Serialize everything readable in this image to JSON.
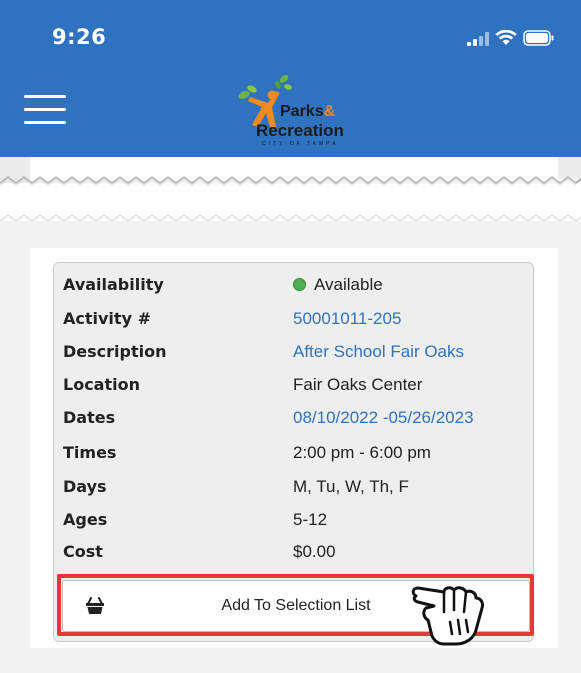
{
  "status_bar": {
    "time": "9:26",
    "icons": [
      "signal-icon",
      "wifi-icon",
      "battery-icon"
    ]
  },
  "header": {
    "menu_icon": "hamburger-menu-icon",
    "logo": {
      "line1": "Parks",
      "ampersand": "&",
      "line2": "Recreation",
      "line3": "CITY OF TAMPA"
    },
    "background_color": "#2f72c0"
  },
  "activity": {
    "rows": [
      {
        "label": "Availability",
        "value": "Available",
        "status_color": "#4caf50"
      },
      {
        "label": "Activity #",
        "value": "50001011-205"
      },
      {
        "label": "Description",
        "value": "After School Fair Oaks"
      },
      {
        "label": "Location",
        "value": "Fair Oaks Center"
      },
      {
        "label": "Dates",
        "value": "08/10/2022 -05/26/2023"
      },
      {
        "label": "Times",
        "value": "2:00 pm - 6:00 pm"
      },
      {
        "label": "Days",
        "value": "M, Tu, W, Th, F"
      },
      {
        "label": "Ages",
        "value": "5-12"
      },
      {
        "label": "Cost",
        "value": "$0.00"
      }
    ]
  },
  "actions": {
    "add_label": "Add To Selection List",
    "add_icon": "basket-icon",
    "highlight_color": "#e53935",
    "pointer_icon": "hand-pointer-icon"
  }
}
